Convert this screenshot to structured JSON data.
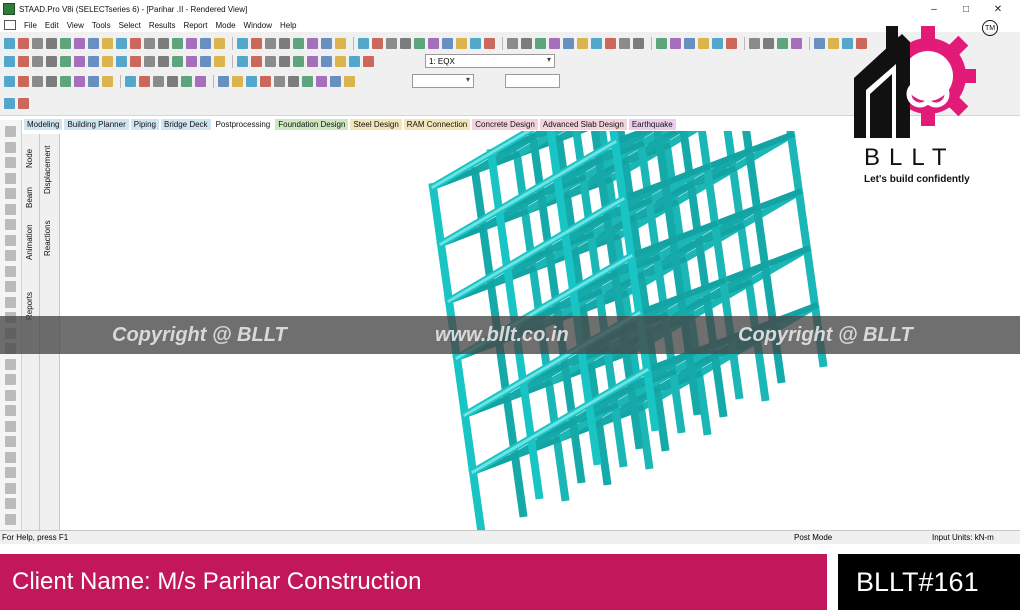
{
  "window": {
    "title": "STAAD.Pro V8i (SELECTseries 6) - [Parihar .II - Rendered View]",
    "controls": [
      "–",
      "□",
      "✕"
    ]
  },
  "menu": [
    "File",
    "Edit",
    "View",
    "Tools",
    "Select",
    "Results",
    "Report",
    "Mode",
    "Window",
    "Help"
  ],
  "toolbar": {
    "load_case": "1: EQX"
  },
  "page_tabs": [
    {
      "label": "Modeling",
      "bg": "#cfe6f2"
    },
    {
      "label": "Building Planner",
      "bg": "#cfe6f2"
    },
    {
      "label": "Piping",
      "bg": "#cfe6f2"
    },
    {
      "label": "Bridge Deck",
      "bg": "#cfe6f2"
    },
    {
      "label": "Postprocessing",
      "bg": "#ffffff"
    },
    {
      "label": "Foundation Design",
      "bg": "#cde8c0"
    },
    {
      "label": "Steel Design",
      "bg": "#f2e5b8"
    },
    {
      "label": "RAM Connection",
      "bg": "#f2e5b8"
    },
    {
      "label": "Concrete Design",
      "bg": "#f3d3dc"
    },
    {
      "label": "Advanced Slab Design",
      "bg": "#f3d3dc"
    },
    {
      "label": "Earthquake",
      "bg": "#eccdf0"
    }
  ],
  "side_tabs": {
    "col1": [
      "Node",
      "Beam",
      "Animation",
      "Reports"
    ],
    "col2": [
      "Displacement",
      "Reactions"
    ]
  },
  "watermark": {
    "left": "Copyright @ BLLT",
    "center": "www.bllt.co.in",
    "right": "Copyright @ BLLT"
  },
  "status": {
    "help": "For Help, press F1",
    "mode": "Post Mode",
    "units": "Input Units:   kN-m"
  },
  "logo": {
    "name": "BLLT",
    "tagline": "Let's build confidently",
    "trademark": "TM"
  },
  "banner": {
    "client": "Client Name: M/s Parihar Construction",
    "code": "BLLT#161"
  },
  "colors": {
    "frame": "#1fbfbf",
    "brand": "#c2185b",
    "gear": "#e21b79"
  }
}
